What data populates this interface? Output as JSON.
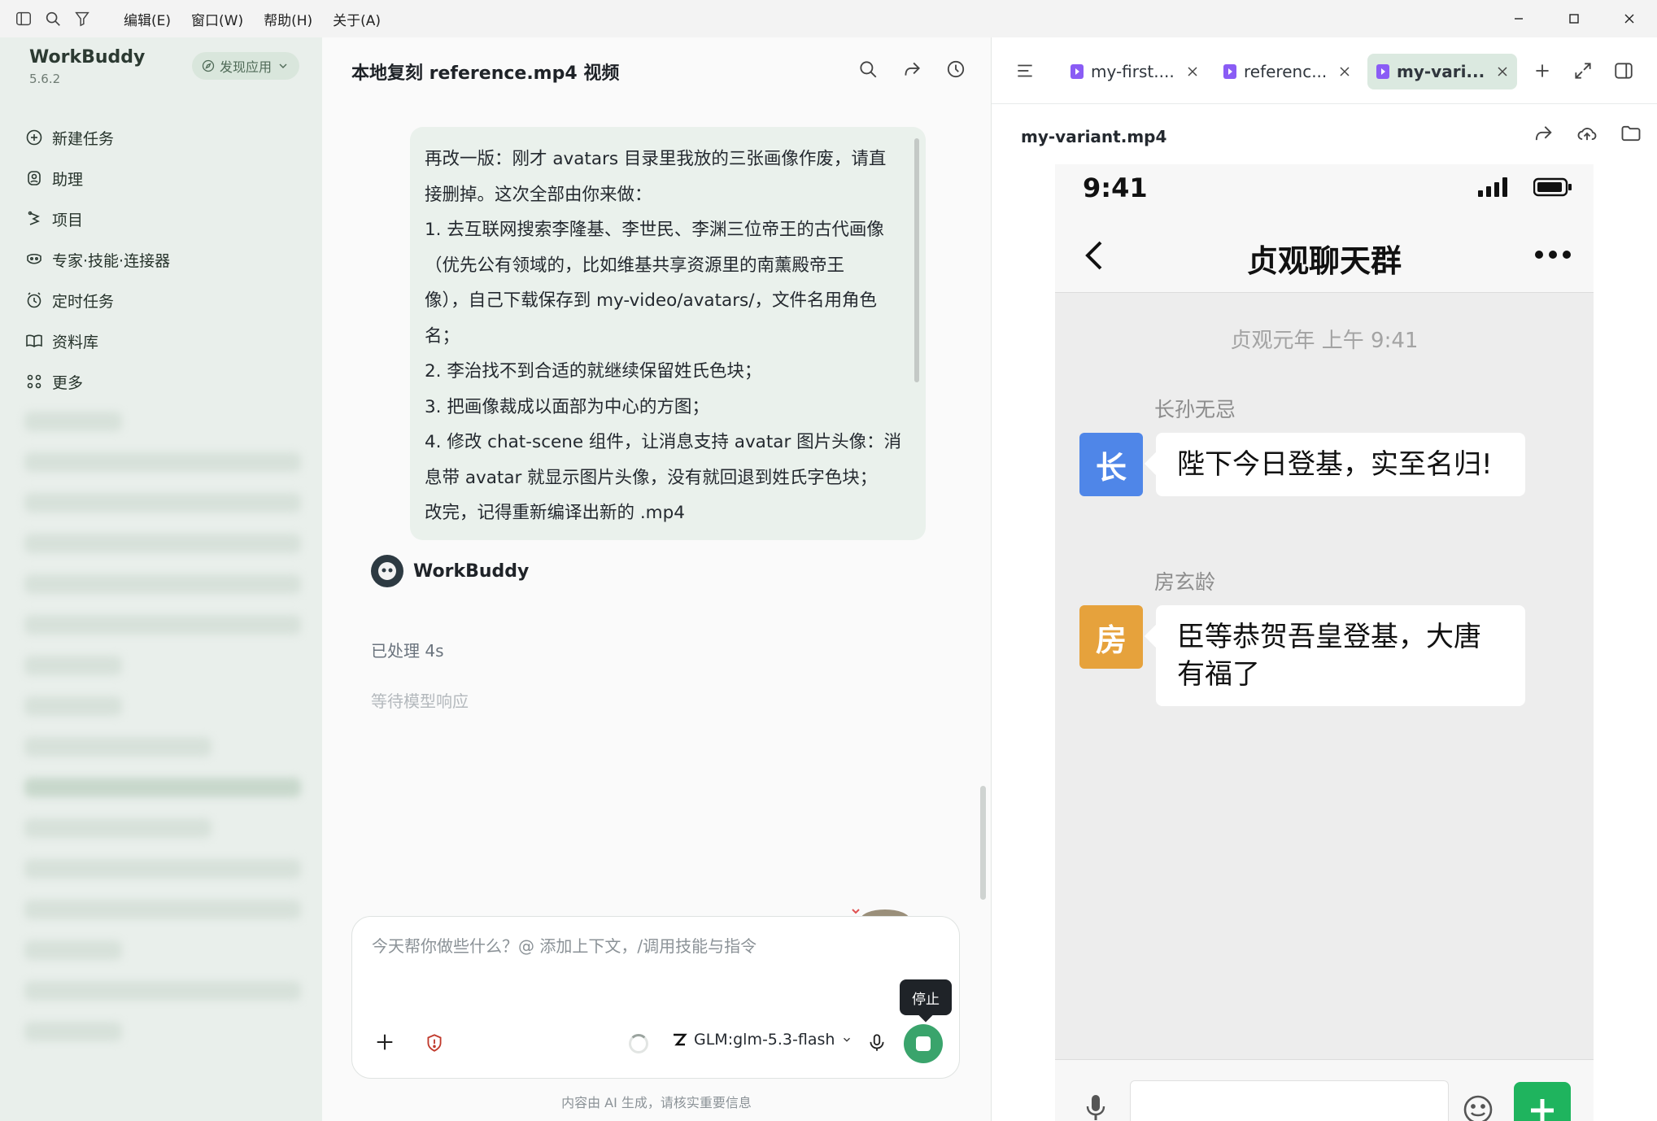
{
  "menu": [
    "编辑(E)",
    "窗口(W)",
    "帮助(H)",
    "关于(A)"
  ],
  "sidebar": {
    "brand": "WorkBuddy",
    "version": "5.6.2",
    "discover_label": "发现应用",
    "items": [
      {
        "label": "新建任务",
        "icon": "new-task-icon"
      },
      {
        "label": "助理",
        "icon": "assistant-icon"
      },
      {
        "label": "项目",
        "icon": "project-icon"
      },
      {
        "label": "专家·技能·连接器",
        "icon": "expert-icon"
      },
      {
        "label": "定时任务",
        "icon": "clock-icon"
      },
      {
        "label": "资料库",
        "icon": "book-icon"
      },
      {
        "label": "更多",
        "icon": "more-grid-icon"
      }
    ]
  },
  "chat": {
    "title": "本地复刻 reference.mp4 视频",
    "user_message_lines": [
      "再改一版：刚才 avatars 目录里我放的三张画像作废，请直",
      "接删掉。这次全部由你来做：",
      "1. 去互联网搜索李隆基、李世民、李渊三位帝王的古代画像",
      "（优先公有领域的，比如维基共享资源里的南薰殿帝王",
      "像），自己下载保存到 my-video/avatars/，文件名用角色",
      "名；",
      "2. 李治找不到合适的就继续保留姓氏色块；",
      "3. 把画像裁成以面部为中心的方图；",
      "4. 修改 chat-scene 组件，让消息支持 avatar 图片头像：消",
      "息带 avatar 就显示图片头像，没有就回退到姓氏字色块；",
      "改完，记得重新编译出新的 .mp4"
    ],
    "bot_name": "WorkBuddy",
    "processed": "已处理 4s",
    "waiting": "等待模型响应",
    "composer_placeholder": "今天帮你做些什么？@ 添加上下文，/调用技能与指令",
    "model": "GLM:glm-5.3-flash",
    "stop_tooltip": "停止",
    "disclaimer": "内容由 AI 生成，请核实重要信息"
  },
  "preview": {
    "tabs": [
      {
        "label": "my-first...."
      },
      {
        "label": "referenc..."
      },
      {
        "label": "my-vari...",
        "active": true
      }
    ],
    "file_title": "my-variant.mp4",
    "phone": {
      "time": "9:41",
      "title": "贞观聊天群",
      "timestamp": "贞观元年 上午 9:41",
      "messages": [
        {
          "sender": "长孙无忌",
          "avatar_char": "长",
          "color": "#4f86e8",
          "text": "陛下今日登基，实至名归!"
        },
        {
          "sender": "房玄龄",
          "avatar_char": "房",
          "color": "#e6a23c",
          "text": "臣等恭贺吾皇登基，大唐有福了"
        }
      ]
    }
  },
  "colors": {
    "sidebar_bg": "#e9efeb",
    "accent_green": "#3aa46c",
    "wechat_green": "#1fb45e"
  }
}
